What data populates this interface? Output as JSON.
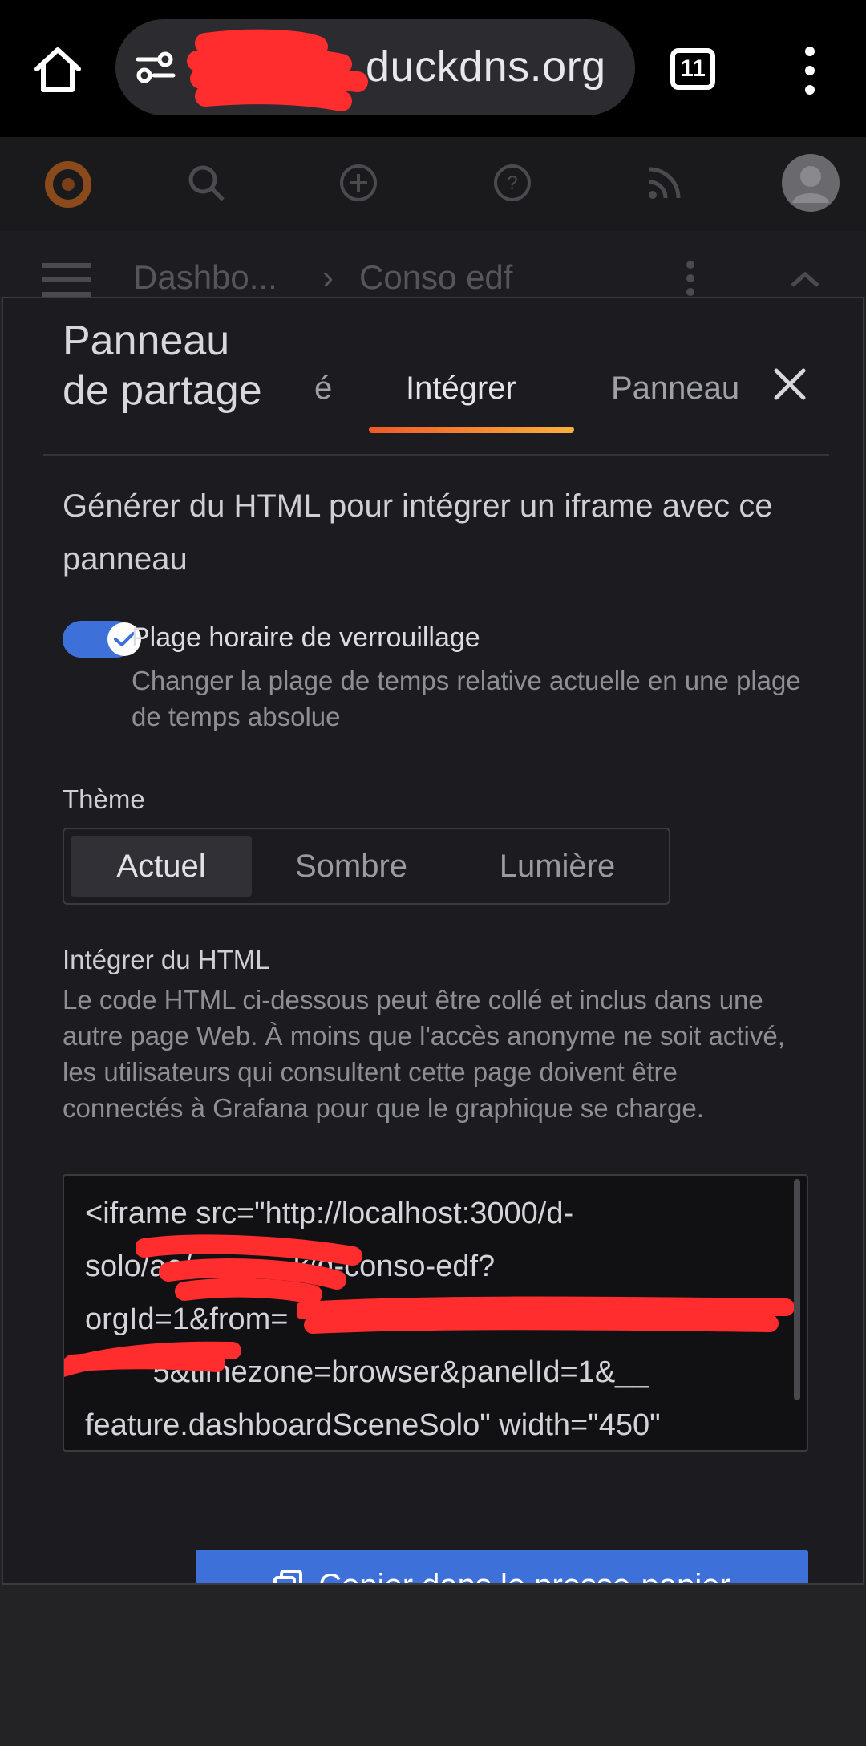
{
  "browser": {
    "url_visible": "duckdns.org",
    "tab_count": "11"
  },
  "grafana": {
    "breadcrumb_root": "Dashbo...",
    "breadcrumb_sep": "›",
    "breadcrumb_current": "Conso edf"
  },
  "drawer": {
    "title": "Panneau de partage",
    "tabs": [
      {
        "label": "é"
      },
      {
        "label": "Intégrer"
      },
      {
        "label": "Panneau"
      }
    ],
    "description": "Générer du HTML pour intégrer un iframe avec ce panneau",
    "toggle": {
      "label": "Plage horaire de verrouillage",
      "description": "Changer la plage de temps relative actuelle en une plage de temps absolue",
      "checked": true
    },
    "theme": {
      "label": "Thème",
      "options": [
        "Actuel",
        "Sombre",
        "Lumière"
      ],
      "selected": "Actuel"
    },
    "embed": {
      "label": "Intégrer du HTML",
      "description": "Le code HTML ci-dessous peut être collé et inclus dans une autre page Web. À moins que l'accès anonyme ne soit activé, les utilisateurs qui consultent cette page doivent être connectés à Grafana pour que le graphique se charge.",
      "code_lines": [
        "<iframe src=\"http://localhost:3000/d-",
        "solo/ae/a          k/d-conso-edf?",
        "orgId=1&from=",
        "        5&timezone=browser&panelId=1&__",
        "feature.dashboardSceneSolo\" width=\"450\""
      ]
    },
    "copy_button": "Copier dans le presse-papier"
  },
  "colors": {
    "accent_blue": "#3d71d9",
    "tab_gradient_start": "#f05a28",
    "tab_gradient_end": "#fbb03b",
    "redaction": "#ff2d2d"
  }
}
